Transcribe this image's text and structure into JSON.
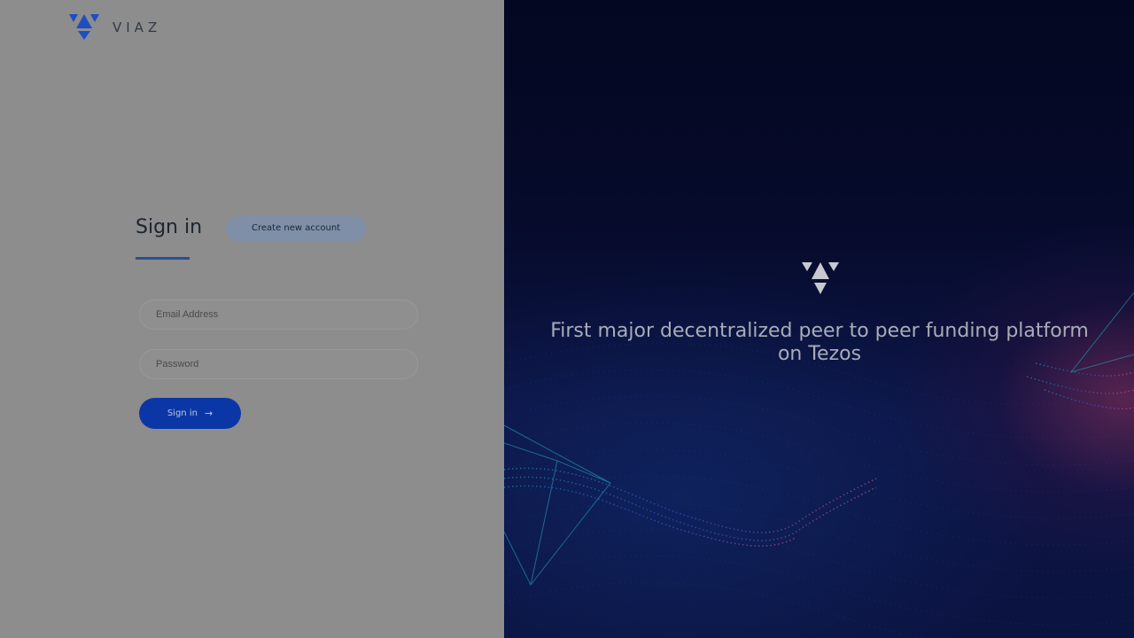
{
  "brand": {
    "name": "VIAZ",
    "logo_icon": "viaz-triangle-logo-icon",
    "logo_color": "#1e4fc2"
  },
  "auth": {
    "signin_tab_label": "Sign in",
    "create_account_label": "Create new account",
    "email_placeholder": "Email Address",
    "password_placeholder": "Password",
    "submit_label": "Sign in",
    "submit_arrow": "→",
    "submit_color": "#0b37a6"
  },
  "hero": {
    "tagline": "First major decentralized peer to peer funding platform on Tezos",
    "logo_icon": "viaz-triangle-logo-icon"
  }
}
